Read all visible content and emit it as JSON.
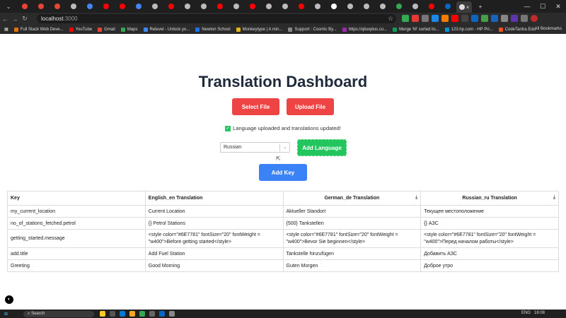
{
  "browser": {
    "url_host": "localhost",
    "url_port": ":3000",
    "bookmarks": [
      {
        "label": "Full Stack Web Deve...",
        "color": "#e8710a"
      },
      {
        "label": "YouTube",
        "color": "#ff0000"
      },
      {
        "label": "Gmail",
        "color": "#ea4335"
      },
      {
        "label": "Maps",
        "color": "#34a853"
      },
      {
        "label": "Relevel - Unlock yo...",
        "color": "#4285f4"
      },
      {
        "label": "Newton School",
        "color": "#1a73e8"
      },
      {
        "label": "Monkeytype | A min...",
        "color": "#e2b714"
      },
      {
        "label": "Support : Cosmic By...",
        "color": "#888888"
      },
      {
        "label": "https://qiluxplus.co...",
        "color": "#9c27b0"
      },
      {
        "label": "Merge 'M' sorted lis...",
        "color": "#0f9d58"
      },
      {
        "label": "123.hp.com - HP Pri...",
        "color": "#0096d6"
      },
      {
        "label": "CodeTantra Edu",
        "color": "#f4511e"
      }
    ],
    "all_bookmarks_label": "All Bookmarks"
  },
  "page": {
    "title": "Translation Dashboard",
    "select_file_label": "Select File",
    "upload_file_label": "Upload File",
    "status_message": "Language uploaded and translations updated!",
    "language_select_value": "Russian",
    "add_language_label": "Add Language",
    "add_key_label": "Add Key"
  },
  "table": {
    "headers": {
      "key": "Key",
      "en": "English_en Translation",
      "de": "German_de Translation",
      "ru": "Russian_ru Translation"
    },
    "rows": [
      {
        "key": "my_current_location",
        "en": "Current Location",
        "de": "Aktueller Standort",
        "ru": "Текущее местоположение"
      },
      {
        "key": "no_of_stations_fetched.petrol",
        "en": "{} Petrol Stations",
        "de": "{500} Tankstellen",
        "ru": "{} АЗС"
      },
      {
        "key": "getting_started.message",
        "en": "<style color=\"#6E7781\" fontSize=\"20\" fontWeight = \"w400\">Before getting started</style>",
        "de": "<style color=\"#6E7781\" fontSize=\"20\" fontWeight = \"w400\">Bevor Sie beginnen</style>",
        "ru": "<style color=\"#6E7781\" fontSize=\"20\" fontWeight = \"w400\">Перед началом работы</style>"
      },
      {
        "key": "add.title",
        "en": "Add Fuel Station",
        "de": "Tankstelle hinzufügen",
        "ru": "Добавить АЗС"
      },
      {
        "key": "Greeting",
        "en": "Good Morning",
        "de": "Guten Morgen",
        "ru": "Доброе утро"
      }
    ]
  },
  "taskbar": {
    "search_placeholder": "Search",
    "lang": "ENG",
    "time": "16:08"
  }
}
